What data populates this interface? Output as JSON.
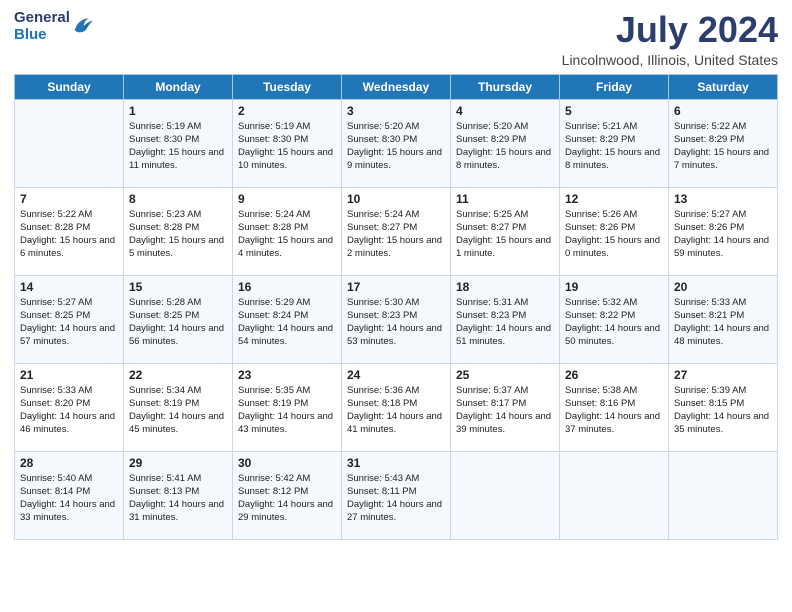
{
  "logo": {
    "general": "General",
    "blue": "Blue"
  },
  "header": {
    "title": "July 2024",
    "subtitle": "Lincolnwood, Illinois, United States"
  },
  "days_of_week": [
    "Sunday",
    "Monday",
    "Tuesday",
    "Wednesday",
    "Thursday",
    "Friday",
    "Saturday"
  ],
  "weeks": [
    [
      {
        "num": "",
        "sunrise": "",
        "sunset": "",
        "daylight": ""
      },
      {
        "num": "1",
        "sunrise": "Sunrise: 5:19 AM",
        "sunset": "Sunset: 8:30 PM",
        "daylight": "Daylight: 15 hours and 11 minutes."
      },
      {
        "num": "2",
        "sunrise": "Sunrise: 5:19 AM",
        "sunset": "Sunset: 8:30 PM",
        "daylight": "Daylight: 15 hours and 10 minutes."
      },
      {
        "num": "3",
        "sunrise": "Sunrise: 5:20 AM",
        "sunset": "Sunset: 8:30 PM",
        "daylight": "Daylight: 15 hours and 9 minutes."
      },
      {
        "num": "4",
        "sunrise": "Sunrise: 5:20 AM",
        "sunset": "Sunset: 8:29 PM",
        "daylight": "Daylight: 15 hours and 8 minutes."
      },
      {
        "num": "5",
        "sunrise": "Sunrise: 5:21 AM",
        "sunset": "Sunset: 8:29 PM",
        "daylight": "Daylight: 15 hours and 8 minutes."
      },
      {
        "num": "6",
        "sunrise": "Sunrise: 5:22 AM",
        "sunset": "Sunset: 8:29 PM",
        "daylight": "Daylight: 15 hours and 7 minutes."
      }
    ],
    [
      {
        "num": "7",
        "sunrise": "Sunrise: 5:22 AM",
        "sunset": "Sunset: 8:28 PM",
        "daylight": "Daylight: 15 hours and 6 minutes."
      },
      {
        "num": "8",
        "sunrise": "Sunrise: 5:23 AM",
        "sunset": "Sunset: 8:28 PM",
        "daylight": "Daylight: 15 hours and 5 minutes."
      },
      {
        "num": "9",
        "sunrise": "Sunrise: 5:24 AM",
        "sunset": "Sunset: 8:28 PM",
        "daylight": "Daylight: 15 hours and 4 minutes."
      },
      {
        "num": "10",
        "sunrise": "Sunrise: 5:24 AM",
        "sunset": "Sunset: 8:27 PM",
        "daylight": "Daylight: 15 hours and 2 minutes."
      },
      {
        "num": "11",
        "sunrise": "Sunrise: 5:25 AM",
        "sunset": "Sunset: 8:27 PM",
        "daylight": "Daylight: 15 hours and 1 minute."
      },
      {
        "num": "12",
        "sunrise": "Sunrise: 5:26 AM",
        "sunset": "Sunset: 8:26 PM",
        "daylight": "Daylight: 15 hours and 0 minutes."
      },
      {
        "num": "13",
        "sunrise": "Sunrise: 5:27 AM",
        "sunset": "Sunset: 8:26 PM",
        "daylight": "Daylight: 14 hours and 59 minutes."
      }
    ],
    [
      {
        "num": "14",
        "sunrise": "Sunrise: 5:27 AM",
        "sunset": "Sunset: 8:25 PM",
        "daylight": "Daylight: 14 hours and 57 minutes."
      },
      {
        "num": "15",
        "sunrise": "Sunrise: 5:28 AM",
        "sunset": "Sunset: 8:25 PM",
        "daylight": "Daylight: 14 hours and 56 minutes."
      },
      {
        "num": "16",
        "sunrise": "Sunrise: 5:29 AM",
        "sunset": "Sunset: 8:24 PM",
        "daylight": "Daylight: 14 hours and 54 minutes."
      },
      {
        "num": "17",
        "sunrise": "Sunrise: 5:30 AM",
        "sunset": "Sunset: 8:23 PM",
        "daylight": "Daylight: 14 hours and 53 minutes."
      },
      {
        "num": "18",
        "sunrise": "Sunrise: 5:31 AM",
        "sunset": "Sunset: 8:23 PM",
        "daylight": "Daylight: 14 hours and 51 minutes."
      },
      {
        "num": "19",
        "sunrise": "Sunrise: 5:32 AM",
        "sunset": "Sunset: 8:22 PM",
        "daylight": "Daylight: 14 hours and 50 minutes."
      },
      {
        "num": "20",
        "sunrise": "Sunrise: 5:33 AM",
        "sunset": "Sunset: 8:21 PM",
        "daylight": "Daylight: 14 hours and 48 minutes."
      }
    ],
    [
      {
        "num": "21",
        "sunrise": "Sunrise: 5:33 AM",
        "sunset": "Sunset: 8:20 PM",
        "daylight": "Daylight: 14 hours and 46 minutes."
      },
      {
        "num": "22",
        "sunrise": "Sunrise: 5:34 AM",
        "sunset": "Sunset: 8:19 PM",
        "daylight": "Daylight: 14 hours and 45 minutes."
      },
      {
        "num": "23",
        "sunrise": "Sunrise: 5:35 AM",
        "sunset": "Sunset: 8:19 PM",
        "daylight": "Daylight: 14 hours and 43 minutes."
      },
      {
        "num": "24",
        "sunrise": "Sunrise: 5:36 AM",
        "sunset": "Sunset: 8:18 PM",
        "daylight": "Daylight: 14 hours and 41 minutes."
      },
      {
        "num": "25",
        "sunrise": "Sunrise: 5:37 AM",
        "sunset": "Sunset: 8:17 PM",
        "daylight": "Daylight: 14 hours and 39 minutes."
      },
      {
        "num": "26",
        "sunrise": "Sunrise: 5:38 AM",
        "sunset": "Sunset: 8:16 PM",
        "daylight": "Daylight: 14 hours and 37 minutes."
      },
      {
        "num": "27",
        "sunrise": "Sunrise: 5:39 AM",
        "sunset": "Sunset: 8:15 PM",
        "daylight": "Daylight: 14 hours and 35 minutes."
      }
    ],
    [
      {
        "num": "28",
        "sunrise": "Sunrise: 5:40 AM",
        "sunset": "Sunset: 8:14 PM",
        "daylight": "Daylight: 14 hours and 33 minutes."
      },
      {
        "num": "29",
        "sunrise": "Sunrise: 5:41 AM",
        "sunset": "Sunset: 8:13 PM",
        "daylight": "Daylight: 14 hours and 31 minutes."
      },
      {
        "num": "30",
        "sunrise": "Sunrise: 5:42 AM",
        "sunset": "Sunset: 8:12 PM",
        "daylight": "Daylight: 14 hours and 29 minutes."
      },
      {
        "num": "31",
        "sunrise": "Sunrise: 5:43 AM",
        "sunset": "Sunset: 8:11 PM",
        "daylight": "Daylight: 14 hours and 27 minutes."
      },
      {
        "num": "",
        "sunrise": "",
        "sunset": "",
        "daylight": ""
      },
      {
        "num": "",
        "sunrise": "",
        "sunset": "",
        "daylight": ""
      },
      {
        "num": "",
        "sunrise": "",
        "sunset": "",
        "daylight": ""
      }
    ]
  ]
}
